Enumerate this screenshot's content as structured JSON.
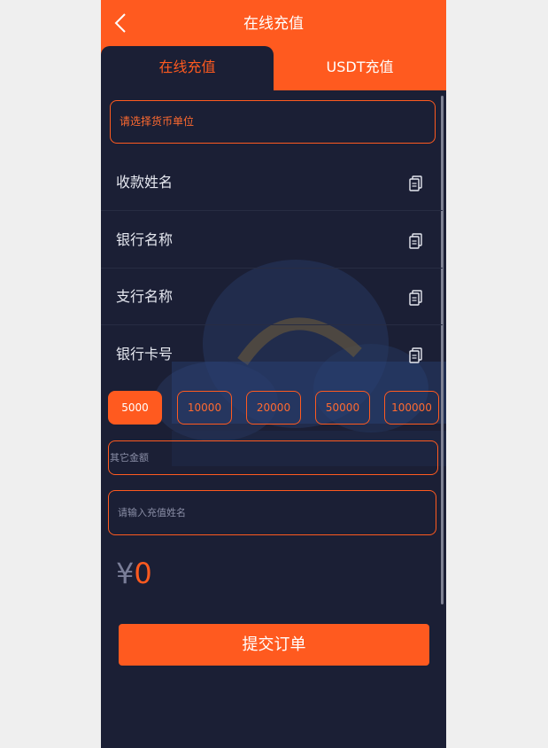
{
  "header": {
    "title": "在线充值",
    "back_icon": "chevron-left-icon"
  },
  "tabs": [
    {
      "label": "在线充值",
      "active": true
    },
    {
      "label": "USDT充值",
      "active": false
    }
  ],
  "currency_select": {
    "placeholder": "请选择货币单位"
  },
  "info_rows": [
    {
      "label": "收款姓名",
      "icon": "copy-icon"
    },
    {
      "label": "银行名称",
      "icon": "copy-icon"
    },
    {
      "label": "支行名称",
      "icon": "copy-icon"
    },
    {
      "label": "银行卡号",
      "icon": "copy-icon"
    }
  ],
  "amount_options": [
    "5000",
    "10000",
    "20000",
    "50000",
    "100000"
  ],
  "selected_amount": "5000",
  "other_amount": {
    "placeholder": "其它金额"
  },
  "name_input": {
    "placeholder": "请输入充值姓名"
  },
  "total": {
    "currency_symbol": "¥",
    "value": "0"
  },
  "submit": {
    "label": "提交订单"
  },
  "colors": {
    "accent": "#ff5a1f",
    "background": "#1b1f35",
    "page": "#efefef"
  }
}
